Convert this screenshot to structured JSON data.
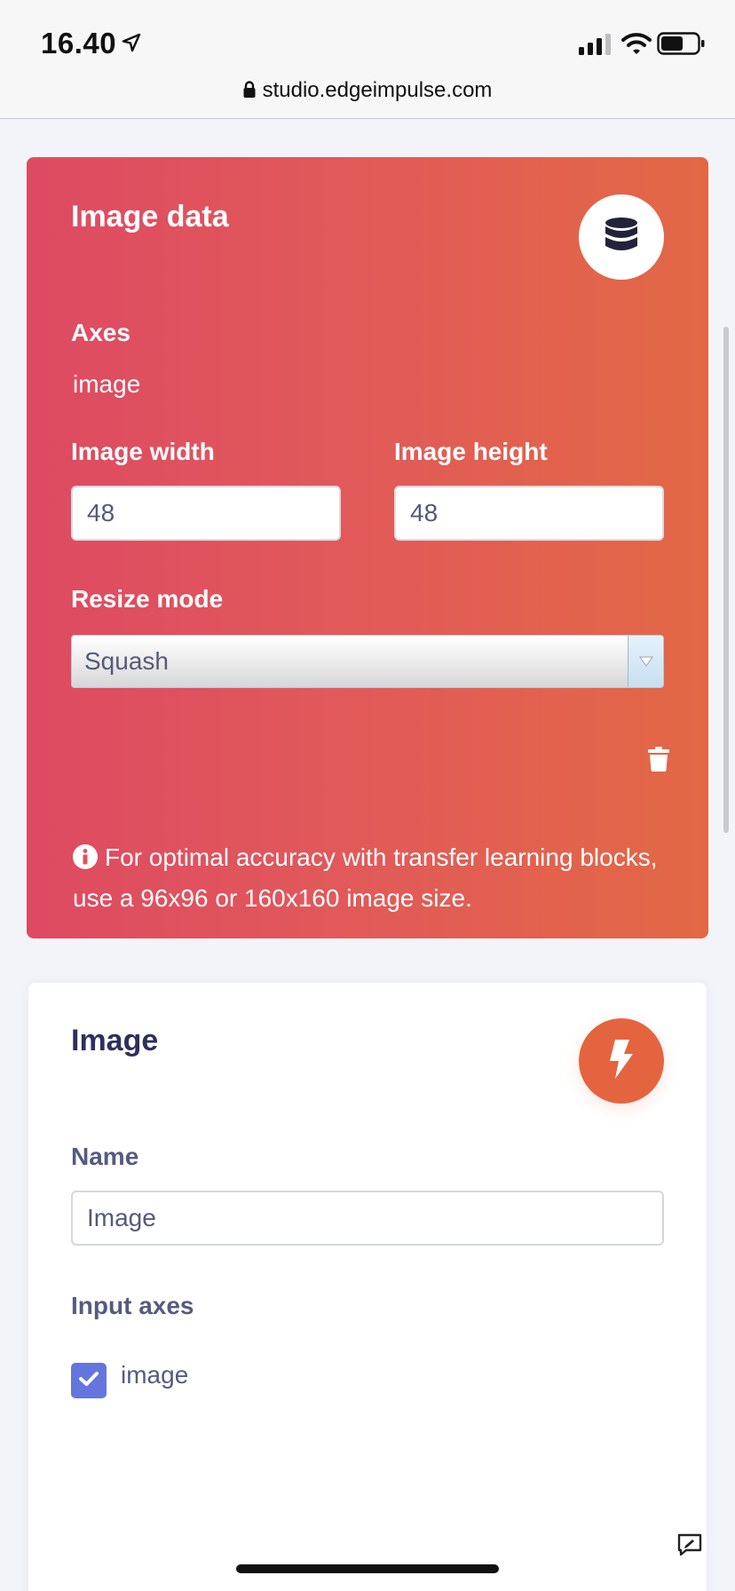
{
  "status_bar": {
    "time": "16.40",
    "url": "studio.edgeimpulse.com"
  },
  "image_data_card": {
    "title": "Image data",
    "icon": "database-icon",
    "axes_label": "Axes",
    "axes_value": "image",
    "width_label": "Image width",
    "width_value": "48",
    "height_label": "Image height",
    "height_value": "48",
    "resize_label": "Resize mode",
    "resize_value": "Squash",
    "info_text": "For optimal accuracy with transfer learning blocks, use a 96x96 or 160x160 image size."
  },
  "image_card": {
    "title": "Image",
    "icon": "lightning-icon",
    "name_label": "Name",
    "name_value": "Image",
    "input_axes_label": "Input axes",
    "checkbox_label": "image",
    "checkbox_checked": true
  },
  "colors": {
    "gradient_start": "#dd4a62",
    "gradient_end": "#e26845",
    "accent_orange": "#e4643f",
    "checkbox_blue": "#6475dd",
    "label_dark": "#545b82"
  }
}
